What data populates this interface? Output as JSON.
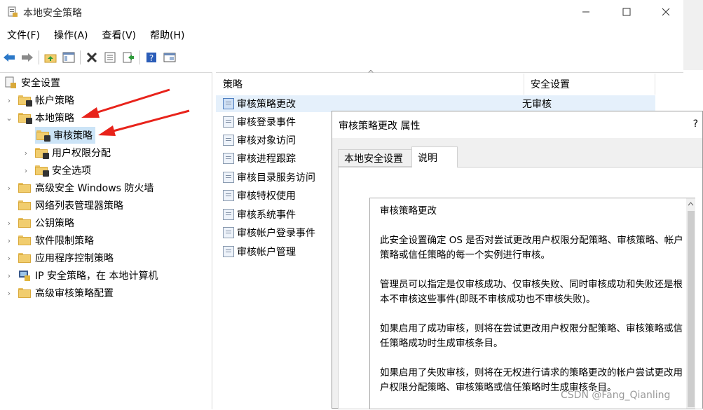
{
  "window": {
    "title": "本地安全策略",
    "minimize_label": "—",
    "maximize_label": "☐",
    "close_label": "✕"
  },
  "menu": [
    {
      "label": "文件(F)"
    },
    {
      "label": "操作(A)"
    },
    {
      "label": "查看(V)"
    },
    {
      "label": "帮助(H)"
    }
  ],
  "toolbar": {
    "icons": [
      "back-arrow-icon",
      "forward-arrow-icon",
      "up-folder-icon",
      "show-tree-icon",
      "delete-icon",
      "properties-icon",
      "export-icon",
      "help-icon",
      "console-icon"
    ]
  },
  "tree": {
    "root": "安全设置",
    "items": [
      {
        "label": "帐户策略"
      },
      {
        "label": "本地策略"
      },
      {
        "label": "审核策略"
      },
      {
        "label": "用户权限分配"
      },
      {
        "label": "安全选项"
      },
      {
        "label": "高级安全 Windows 防火墙"
      },
      {
        "label": "网络列表管理器策略"
      },
      {
        "label": "公钥策略"
      },
      {
        "label": "软件限制策略"
      },
      {
        "label": "应用程序控制策略"
      },
      {
        "label": "IP 安全策略，在 本地计算机"
      },
      {
        "label": "高级审核策略配置"
      }
    ]
  },
  "list": {
    "columns": {
      "policy": "策略",
      "setting": "安全设置"
    },
    "sort_indicator": "^",
    "rows": [
      {
        "policy": "审核策略更改",
        "setting": "无审核"
      },
      {
        "policy": "审核登录事件",
        "setting": ""
      },
      {
        "policy": "审核对象访问",
        "setting": ""
      },
      {
        "policy": "审核进程跟踪",
        "setting": ""
      },
      {
        "policy": "审核目录服务访问",
        "setting": ""
      },
      {
        "policy": "审核特权使用",
        "setting": ""
      },
      {
        "policy": "审核系统事件",
        "setting": ""
      },
      {
        "policy": "审核帐户登录事件",
        "setting": ""
      },
      {
        "policy": "审核帐户管理",
        "setting": ""
      }
    ]
  },
  "dialog": {
    "title": "审核策略更改 属性",
    "help": "?",
    "tabs": [
      "本地安全设置",
      "说明"
    ],
    "description": [
      "审核策略更改",
      "此安全设置确定 OS 是否对尝试更改用户权限分配策略、审核策略、帐户策略或信任策略的每一个实例进行审核。",
      "管理员可以指定是仅审核成功、仅审核失败、同时审核成功和失败还是根本不审核这些事件(即既不审核成功也不审核失败)。",
      "如果启用了成功审核，则将在尝试更改用户权限分配策略、审核策略或信任策略成功时生成审核条目。",
      "如果启用了失败审核，则将在无权进行请求的策略更改的帐户尝试更改用户权限分配策略、审核策略或信任策略时生成审核条目。"
    ]
  },
  "watermark": "CSDN @Fang_Qianling",
  "colors": {
    "selection": "#cce4f7",
    "arrow": "#e8231b",
    "folder": "#f1cd6e"
  }
}
